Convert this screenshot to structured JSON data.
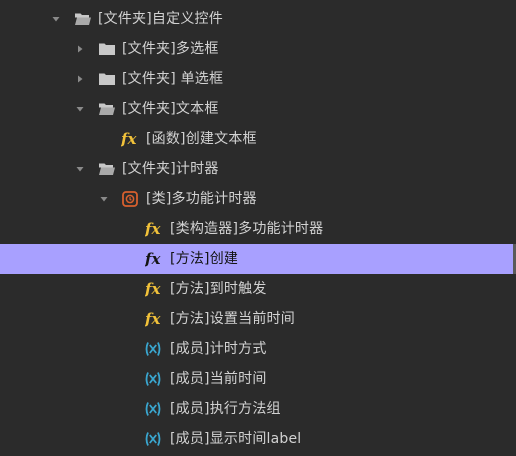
{
  "tree": {
    "items": [
      {
        "label": "[文件夹]自定义控件",
        "icon": "folder-open-icon",
        "expanded": true
      },
      {
        "label": "[文件夹]多选框",
        "icon": "folder-icon",
        "expanded": false
      },
      {
        "label": "[文件夹] 单选框",
        "icon": "folder-icon",
        "expanded": false
      },
      {
        "label": "[文件夹]文本框",
        "icon": "folder-open-icon",
        "expanded": true
      },
      {
        "label": "[函数]创建文本框",
        "icon": "function-icon"
      },
      {
        "label": "[文件夹]计时器",
        "icon": "folder-open-icon",
        "expanded": true
      },
      {
        "label": "[类]多功能计时器",
        "icon": "class-icon",
        "expanded": true
      },
      {
        "label": "[类构造器]多功能计时器",
        "icon": "function-icon"
      },
      {
        "label": "[方法]创建",
        "icon": "function-icon",
        "selected": true
      },
      {
        "label": "[方法]到时触发",
        "icon": "function-icon"
      },
      {
        "label": "[方法]设置当前时间",
        "icon": "function-icon"
      },
      {
        "label": "[成员]计时方式",
        "icon": "member-icon"
      },
      {
        "label": "[成员]当前时间",
        "icon": "member-icon"
      },
      {
        "label": "[成员]执行方法组",
        "icon": "member-icon"
      },
      {
        "label": "[成员]显示时间label",
        "icon": "member-icon"
      }
    ]
  },
  "colors": {
    "background": "#2b2b2b",
    "text": "#d2d2d2",
    "selected_background": "#a8a0ff",
    "function_icon": "#f2c23a",
    "member_icon": "#3aa6cf",
    "class_icon": "#d8602e",
    "folder_icon": "#c8c8c8"
  }
}
